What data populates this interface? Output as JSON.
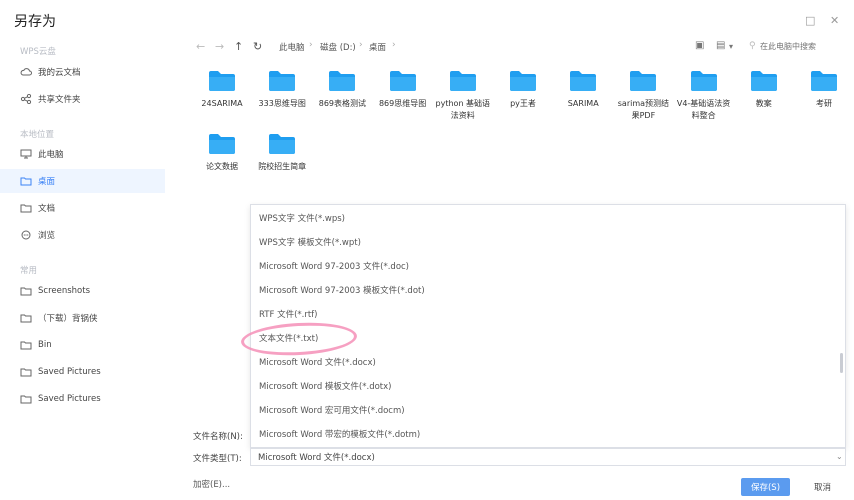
{
  "dialog": {
    "title": "另存为"
  },
  "sidebar": {
    "sections": [
      {
        "title": "WPS云盘",
        "items": [
          {
            "label": "我的云文档",
            "icon": "cloud-icon"
          },
          {
            "label": "共享文件夹",
            "icon": "share-icon"
          }
        ]
      },
      {
        "title": "本地位置",
        "items": [
          {
            "label": "此电脑",
            "icon": "monitor-icon"
          },
          {
            "label": "桌面",
            "icon": "folder-icon",
            "active": true
          },
          {
            "label": "文档",
            "icon": "folder-icon"
          },
          {
            "label": "浏览",
            "icon": "browse-icon"
          }
        ]
      },
      {
        "title": "常用",
        "items": [
          {
            "label": "Screenshots",
            "icon": "folder-icon"
          },
          {
            "label": "（下载）背锅侠",
            "icon": "folder-icon"
          },
          {
            "label": "Bin",
            "icon": "folder-icon"
          },
          {
            "label": "Saved Pictures",
            "icon": "folder-icon"
          },
          {
            "label": "Saved Pictures",
            "icon": "folder-icon"
          }
        ]
      }
    ]
  },
  "breadcrumb": [
    "此电脑",
    "磁盘 (D:)",
    "桌面"
  ],
  "search": {
    "placeholder": "在此电脑中搜索"
  },
  "folders": [
    "24SARIMA",
    "333思维导图",
    "869表格测试",
    "869思维导图",
    "python 基础语法资料",
    "py王者",
    "SARIMA",
    "sarima预测结果PDF",
    "V4-基础语法资料整合",
    "教案",
    "考研",
    "论文数据",
    "院校招生简章"
  ],
  "file_types": [
    "WPS文字 文件(*.wps)",
    "WPS文字 模板文件(*.wpt)",
    "Microsoft Word 97-2003 文件(*.doc)",
    "Microsoft Word 97-2003 模板文件(*.dot)",
    "RTF 文件(*.rtf)",
    "文本文件(*.txt)",
    "Microsoft Word 文件(*.docx)",
    "Microsoft Word 模板文件(*.dotx)",
    "Microsoft Word 宏可用文件(*.docm)",
    "Microsoft Word 带宏的模板文件(*.dotm)"
  ],
  "form": {
    "filename_label": "文件名称(N):",
    "filetype_label": "文件类型(T):",
    "filetype_value": "Microsoft Word 文件(*.docx)"
  },
  "buttons": {
    "encrypt": "加密(E)...",
    "save": "保存(S)",
    "cancel": "取消"
  },
  "colors": {
    "accent": "#5b9bef",
    "folder": "#2aa4f4",
    "highlight_ellipse": "#f58fb7"
  }
}
